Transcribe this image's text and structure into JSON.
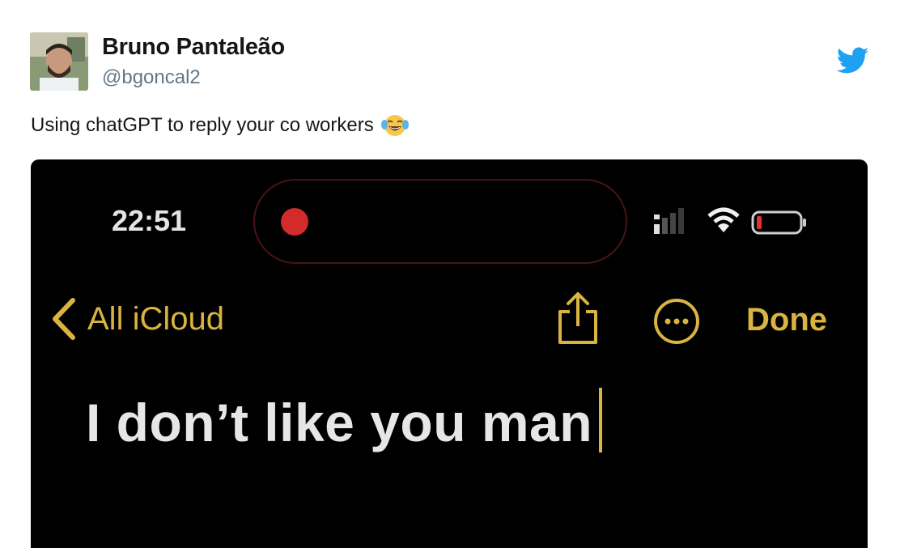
{
  "tweet": {
    "author_name": "Bruno Pantaleão",
    "author_handle": "@bgoncal2",
    "text": "Using chatGPT to reply your co workers",
    "emoji": "face-with-tears-of-joy",
    "brand_color": "#1da1f2"
  },
  "phone": {
    "time": "22:51",
    "back_label": "All iCloud",
    "done_label": "Done",
    "note_text": "I don’t like you man",
    "accent_color": "#d9b440",
    "recording_color": "#d32a2a",
    "icons": [
      "chevron-left-icon",
      "share-icon",
      "more-icon",
      "signal-icon",
      "wifi-icon",
      "battery-icon",
      "recording-dot-icon"
    ]
  }
}
